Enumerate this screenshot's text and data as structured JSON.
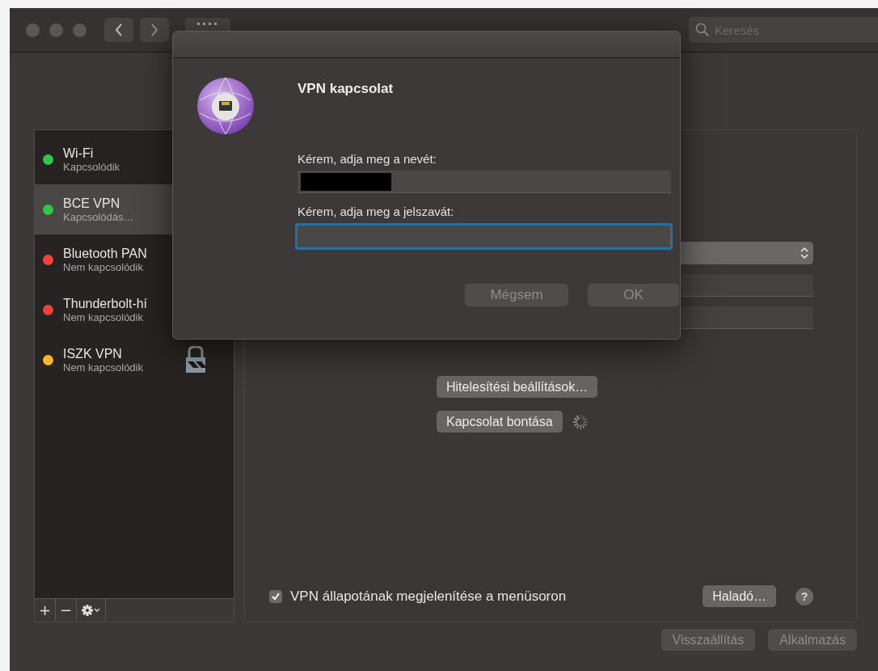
{
  "window": {
    "search": {
      "placeholder": "Keresés"
    }
  },
  "sidebar": {
    "items": [
      {
        "name": "Wi-Fi",
        "status": "Kapcsolódik",
        "color": "#2ec84a",
        "selected": false
      },
      {
        "name": "BCE VPN",
        "status": "Kapcsolódás…",
        "color": "#2ec84a",
        "selected": true
      },
      {
        "name": "Bluetooth PAN",
        "status": "Nem kapcsolódik",
        "color": "#f0443a",
        "selected": false
      },
      {
        "name": "Thunderbolt-hí",
        "status": "Nem kapcsolódik",
        "color": "#f0443a",
        "selected": false
      },
      {
        "name": "ISZK VPN",
        "status": "Nem kapcsolódik",
        "color": "#f6b52a",
        "selected": false,
        "locked": true
      }
    ],
    "toolbar": [
      "+",
      "−"
    ]
  },
  "panel": {
    "buttons": [
      "Hitelesítési beállítások…",
      "Kapcsolat bontása"
    ],
    "busy": true,
    "status_checkbox": {
      "label": "VPN állapotának megjelenítése a menüsoron",
      "checked": true
    },
    "advanced_button": "Haladó…",
    "help": "?"
  },
  "footer_buttons": [
    {
      "label": "Visszaállítás",
      "disabled": true
    },
    {
      "label": "Alkalmazás",
      "disabled": true
    }
  ],
  "dialog": {
    "title": "VPN kapcsolat",
    "name_label": "Kérem, adja meg a nevét:",
    "name_redacted": true,
    "password_label": "Kérem, adja meg a jelszavát:",
    "password_focused": true,
    "buttons": [
      {
        "label": "Mégsem",
        "disabled": true
      },
      {
        "label": "OK",
        "disabled": true
      }
    ]
  }
}
